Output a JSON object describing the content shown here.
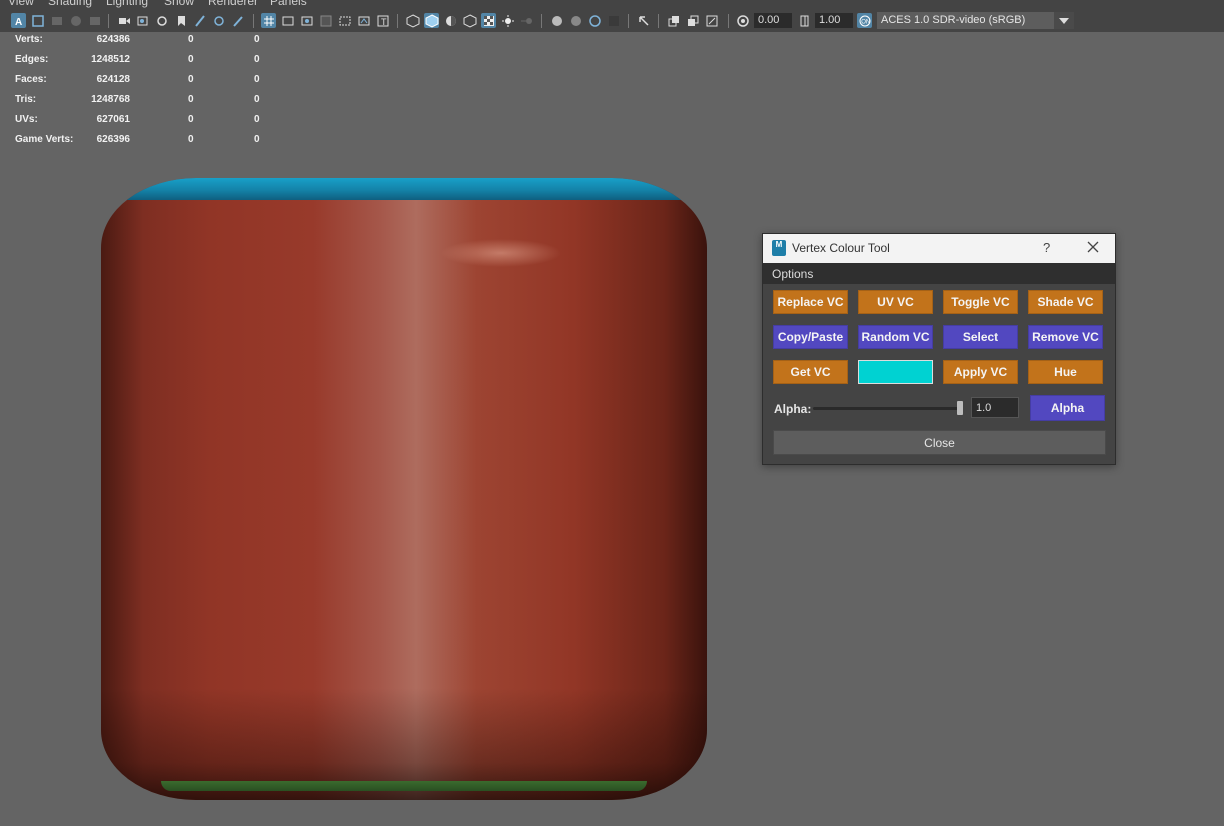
{
  "menubar": {
    "items": [
      "View",
      "Shading",
      "Lighting",
      "Show",
      "Renderer",
      "Panels"
    ]
  },
  "toolbar": {
    "exposure_value": "0.00",
    "gamma_value": "1.00",
    "color_space": "ACES 1.0 SDR-video (sRGB)",
    "icons": [
      "select-camera-icon",
      "camera-attributes-icon",
      "bookmark-icon",
      "image-plane-icon",
      "2d-pan-zoom-icon",
      "grease-pencil-icon",
      "grid-icon",
      "film-gate-icon",
      "resolution-gate-icon",
      "gate-mask-icon",
      "field-chart-icon",
      "safe-action-icon",
      "safe-title-icon",
      "wireframe-icon",
      "smooth-shade-icon",
      "default-material-icon",
      "wireframe-on-shaded-icon",
      "xray-icon",
      "use-all-lights-icon",
      "shadows-icon",
      "screen-space-ao-icon",
      "motion-blur-icon",
      "anti-aliasing-icon",
      "depth-of-field-icon",
      "isolate-select-icon",
      "xray-joints-icon",
      "xray-active-icon",
      "exposure-icon",
      "gamma-icon",
      "color-management-icon"
    ]
  },
  "hud": {
    "rows": [
      {
        "label": "Verts:",
        "v1": "624386",
        "v2": "0",
        "v3": "0"
      },
      {
        "label": "Edges:",
        "v1": "1248512",
        "v2": "0",
        "v3": "0"
      },
      {
        "label": "Faces:",
        "v1": "624128",
        "v2": "0",
        "v3": "0"
      },
      {
        "label": "Tris:",
        "v1": "1248768",
        "v2": "0",
        "v3": "0"
      },
      {
        "label": "UVs:",
        "v1": "627061",
        "v2": "0",
        "v3": "0"
      },
      {
        "label": "Game Verts:",
        "v1": "626396",
        "v2": "0",
        "v3": "0"
      }
    ]
  },
  "dialog": {
    "title": "Vertex Colour Tool",
    "logo_text": "M",
    "help_label": "?",
    "options_menu": "Options",
    "buttons": [
      {
        "label": "Replace VC",
        "color": "#c2731b"
      },
      {
        "label": "UV VC",
        "color": "#c2731b"
      },
      {
        "label": "Toggle VC",
        "color": "#c2731b"
      },
      {
        "label": "Shade VC",
        "color": "#c2731b"
      },
      {
        "label": "Copy/Paste",
        "color": "#5248c0"
      },
      {
        "label": "Random VC",
        "color": "#5248c0"
      },
      {
        "label": "Select",
        "color": "#5248c0"
      },
      {
        "label": "Remove VC",
        "color": "#5248c0"
      },
      {
        "label": "Get VC",
        "color": "#c2731b"
      },
      {
        "label": "",
        "color": "#00d2d2"
      },
      {
        "label": "Apply VC",
        "color": "#c2731b"
      },
      {
        "label": "Hue",
        "color": "#c2731b"
      }
    ],
    "swatch_color": "#00d2d2",
    "alpha_label": "Alpha:",
    "alpha_value": "1.0",
    "alpha_slider_fraction": 1.0,
    "alpha_button": "Alpha",
    "close_button": "Close"
  },
  "viewport": {
    "background_color": "#646464",
    "mesh_colors": {
      "body": "#963828",
      "top": "#1496c0",
      "bottom": "#3a6b2e"
    }
  }
}
